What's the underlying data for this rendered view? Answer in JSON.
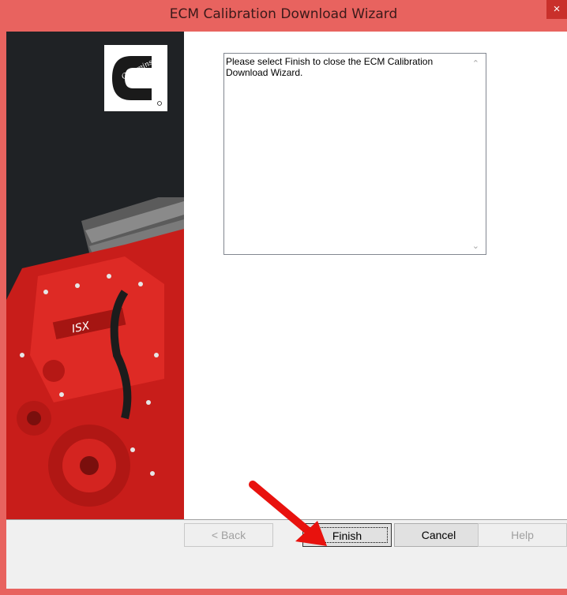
{
  "window": {
    "title": "ECM Calibration Download Wizard",
    "close_glyph": "×",
    "accent_color": "#e8635f"
  },
  "banner": {
    "logo_icon": "cummins-logo",
    "engine_badge": "ISX"
  },
  "message": {
    "text": "Please select Finish to close the ECM Calibration Download Wizard."
  },
  "buttons": {
    "back": "< Back",
    "finish": "Finish",
    "cancel": "Cancel",
    "help": "Help"
  },
  "annotation": {
    "arrow_color": "#e8120e"
  }
}
